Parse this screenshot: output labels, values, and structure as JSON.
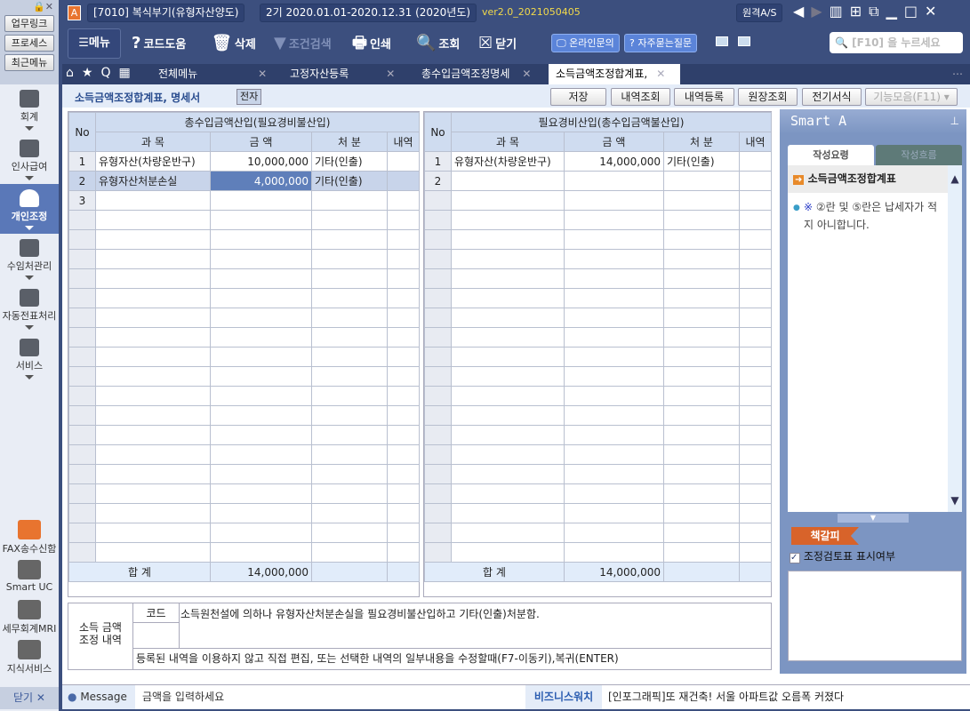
{
  "leftbar": {
    "top_buttons": [
      "업무링크",
      "프로세스",
      "최근메뉴"
    ],
    "nav": [
      {
        "label": "회계"
      },
      {
        "label": "인사급여"
      },
      {
        "label": "개인조정",
        "active": true
      },
      {
        "label": "수임처관리"
      },
      {
        "label": "자동전표처리"
      },
      {
        "label": "서비스"
      }
    ],
    "bottom": [
      "FAX송수신함",
      "Smart UC",
      "세무회계MRI",
      "지식서비스"
    ],
    "close_label": "닫기"
  },
  "titlebar": {
    "program": "[7010] 복식부기(유형자산양도)",
    "period": "2기  2020.01.01-2020.12.31",
    "year": "(2020년도)",
    "version": "ver2.0_2021050405",
    "remote": "원격A/S"
  },
  "toolbar": {
    "menu": "메뉴",
    "code_help": "코드도움",
    "delete": "삭제",
    "filter": "조건검색",
    "print": "인쇄",
    "lookup": "조회",
    "close": "닫기",
    "online": "온라인문의",
    "faq": "자주묻는질문",
    "search_placeholder": "[F10] 을 누르세요"
  },
  "tabs": [
    {
      "label": "전체메뉴"
    },
    {
      "label": "고정자산등록"
    },
    {
      "label": "총수입금액조정명세"
    },
    {
      "label": "소득금액조정합계표,",
      "active": true
    }
  ],
  "page": {
    "title": "소득금액조정합계표, 명세서",
    "badge": "전자",
    "buttons": [
      "저장",
      "내역조회",
      "내역등록",
      "원장조회",
      "전기서식",
      "기능모음(F11) ▾"
    ]
  },
  "left_table": {
    "title": "총수입금액산입(필요경비불산입)",
    "cols": [
      "No",
      "과   목",
      "금   액",
      "처   분",
      "내역"
    ],
    "rows": [
      {
        "no": "1",
        "item": "유형자산(차량운반구)",
        "amount": "10,000,000",
        "disp": "기타(인출)"
      },
      {
        "no": "2",
        "item": "유형자산처분손실",
        "amount": "4,000,000",
        "disp": "기타(인출)"
      },
      {
        "no": "3",
        "item": "",
        "amount": "",
        "disp": ""
      }
    ],
    "total_label": "합 계",
    "total": "14,000,000"
  },
  "right_table": {
    "title": "필요경비산입(총수입금액불산입)",
    "cols": [
      "No",
      "과   목",
      "금   액",
      "처   분",
      "내역"
    ],
    "rows": [
      {
        "no": "1",
        "item": "유형자산(차량운반구)",
        "amount": "14,000,000",
        "disp": "기타(인출)"
      },
      {
        "no": "2",
        "item": "",
        "amount": "",
        "disp": ""
      }
    ],
    "total_label": "합 계",
    "total": "14,000,000"
  },
  "memo": {
    "label1": "소득 금액",
    "label2": "조정 내역",
    "code_label": "코드",
    "text": "소득원천설에 의하나 유형자산처분손실을 필요경비불산입하고 기타(인출)처분함.",
    "hint": "등록된 내역을 이용하지 않고 직접 편집, 또는 선택한 내역의 일부내용을 수정할때(F7-이동키),복귀(ENTER)"
  },
  "smart": {
    "title": "Smart A",
    "tab1": "작성요령",
    "tab2": "작성흐름",
    "heading": "소득금액조정합계표",
    "note_mark": "※",
    "note": " ②란 및 ⑤란은 납세자가 적지 아니합니다.",
    "bookmark": "책갈피",
    "checkbox": "조정검토표 표시여부",
    "checked": true
  },
  "status": {
    "message_label": "Message",
    "message": "금액을 입력하세요",
    "biz_label": "비즈니스워치",
    "news": "[인포그래픽]또 재건축! 서울 아파트값 오름폭 커졌다"
  }
}
